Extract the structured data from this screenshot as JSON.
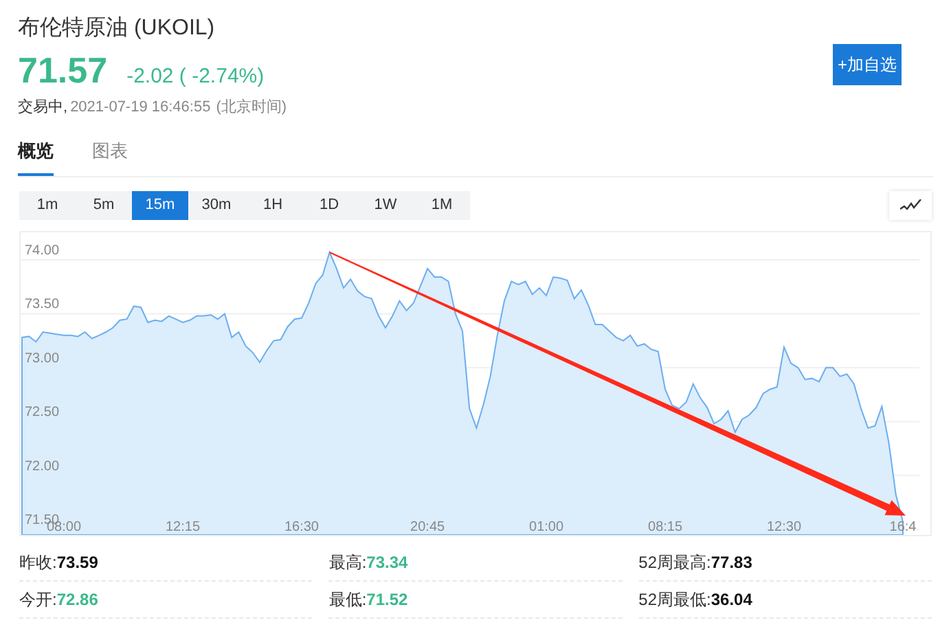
{
  "header": {
    "title": "布伦特原油 (UKOIL)",
    "price": "71.57",
    "change": "-2.02 ( -2.74%)",
    "status": "交易中,",
    "timestamp": "2021-07-19 16:46:55",
    "timezone": "(北京时间)",
    "watchlist_button": "+加自选"
  },
  "tabs": [
    {
      "label": "概览",
      "selected": true
    },
    {
      "label": "图表",
      "selected": false
    }
  ],
  "intervals": [
    {
      "label": "1m",
      "selected": false
    },
    {
      "label": "5m",
      "selected": false
    },
    {
      "label": "15m",
      "selected": true
    },
    {
      "label": "30m",
      "selected": false
    },
    {
      "label": "1H",
      "selected": false
    },
    {
      "label": "1D",
      "selected": false
    },
    {
      "label": "1W",
      "selected": false
    },
    {
      "label": "1M",
      "selected": false
    }
  ],
  "chart_data": {
    "type": "area",
    "grid": true,
    "categories": [
      null,
      null,
      null,
      null,
      null,
      null,
      "08:00",
      null,
      null,
      null,
      null,
      null,
      null,
      null,
      null,
      null,
      null,
      null,
      null,
      null,
      null,
      null,
      null,
      "12:15",
      null,
      null,
      null,
      null,
      null,
      null,
      null,
      null,
      null,
      null,
      null,
      null,
      null,
      null,
      null,
      null,
      "16:30",
      null,
      null,
      null,
      null,
      null,
      null,
      null,
      null,
      null,
      null,
      null,
      null,
      null,
      null,
      null,
      null,
      null,
      "20:45",
      null,
      null,
      null,
      null,
      null,
      null,
      null,
      null,
      null,
      null,
      null,
      null,
      null,
      null,
      null,
      null,
      "01:00",
      null,
      null,
      null,
      null,
      null,
      null,
      null,
      null,
      null,
      null,
      null,
      null,
      null,
      null,
      null,
      null,
      "08:15",
      null,
      null,
      null,
      null,
      null,
      null,
      null,
      null,
      null,
      null,
      null,
      null,
      null,
      null,
      null,
      null,
      "12:30",
      null,
      null,
      null,
      null,
      null,
      null,
      null,
      null,
      null,
      null,
      null,
      null,
      null,
      null,
      null,
      null,
      "16:4"
    ],
    "ylim": [
      71.449,
      74.255
    ],
    "yticks": [
      {
        "value": 71.5,
        "label": "71.50"
      },
      {
        "value": 72,
        "label": "72.00"
      },
      {
        "value": 72.5,
        "label": "72.50"
      },
      {
        "value": 73,
        "label": "73.00"
      },
      {
        "value": 73.5,
        "label": "73.50"
      },
      {
        "value": 74,
        "label": "74.00"
      }
    ],
    "series": [
      {
        "color": "#6aaef0",
        "values": [
          73.28,
          73.29,
          73.24,
          73.33,
          73.32,
          73.31,
          73.3,
          73.3,
          73.29,
          73.33,
          73.27,
          73.3,
          73.33,
          73.37,
          73.44,
          73.45,
          73.57,
          73.56,
          73.42,
          73.44,
          73.43,
          73.48,
          73.45,
          73.42,
          73.44,
          73.48,
          73.48,
          73.49,
          73.45,
          73.5,
          73.28,
          73.33,
          73.2,
          73.14,
          73.05,
          73.16,
          73.25,
          73.26,
          73.38,
          73.45,
          73.46,
          73.6,
          73.78,
          73.86,
          74.07,
          73.92,
          73.74,
          73.82,
          73.71,
          73.66,
          73.64,
          73.48,
          73.37,
          73.48,
          73.62,
          73.53,
          73.6,
          73.76,
          73.92,
          73.84,
          73.84,
          73.8,
          73.5,
          73.34,
          72.62,
          72.44,
          72.66,
          72.92,
          73.3,
          73.62,
          73.8,
          73.77,
          73.8,
          73.68,
          73.74,
          73.67,
          73.84,
          73.83,
          73.81,
          73.64,
          73.72,
          73.58,
          73.4,
          73.4,
          73.34,
          73.28,
          73.25,
          73.3,
          73.2,
          73.22,
          73.17,
          73.15,
          72.8,
          72.65,
          72.62,
          72.68,
          72.85,
          72.72,
          72.63,
          72.48,
          72.52,
          72.6,
          72.4,
          72.52,
          72.56,
          72.63,
          72.76,
          72.8,
          72.82,
          73.19,
          73.04,
          73.0,
          72.89,
          72.9,
          72.87,
          73.0,
          73.0,
          72.92,
          72.94,
          72.85,
          72.62,
          72.44,
          72.46,
          72.64,
          72.3,
          71.82,
          71.57
        ]
      }
    ]
  },
  "markup_arrow": {
    "color": "#ff2a1a"
  },
  "stats": [
    {
      "label": "昨收:",
      "value": "73.59",
      "color": "#111111"
    },
    {
      "label": "最高:",
      "value": "73.34",
      "color": "#3bb98b"
    },
    {
      "label": "52周最高:",
      "value": "77.83",
      "color": "#111111"
    },
    {
      "label": "今开:",
      "value": "72.86",
      "color": "#3bb98b"
    },
    {
      "label": "最低:",
      "value": "71.52",
      "color": "#3bb98b"
    },
    {
      "label": "52周最低:",
      "value": "36.04",
      "color": "#111111"
    }
  ]
}
